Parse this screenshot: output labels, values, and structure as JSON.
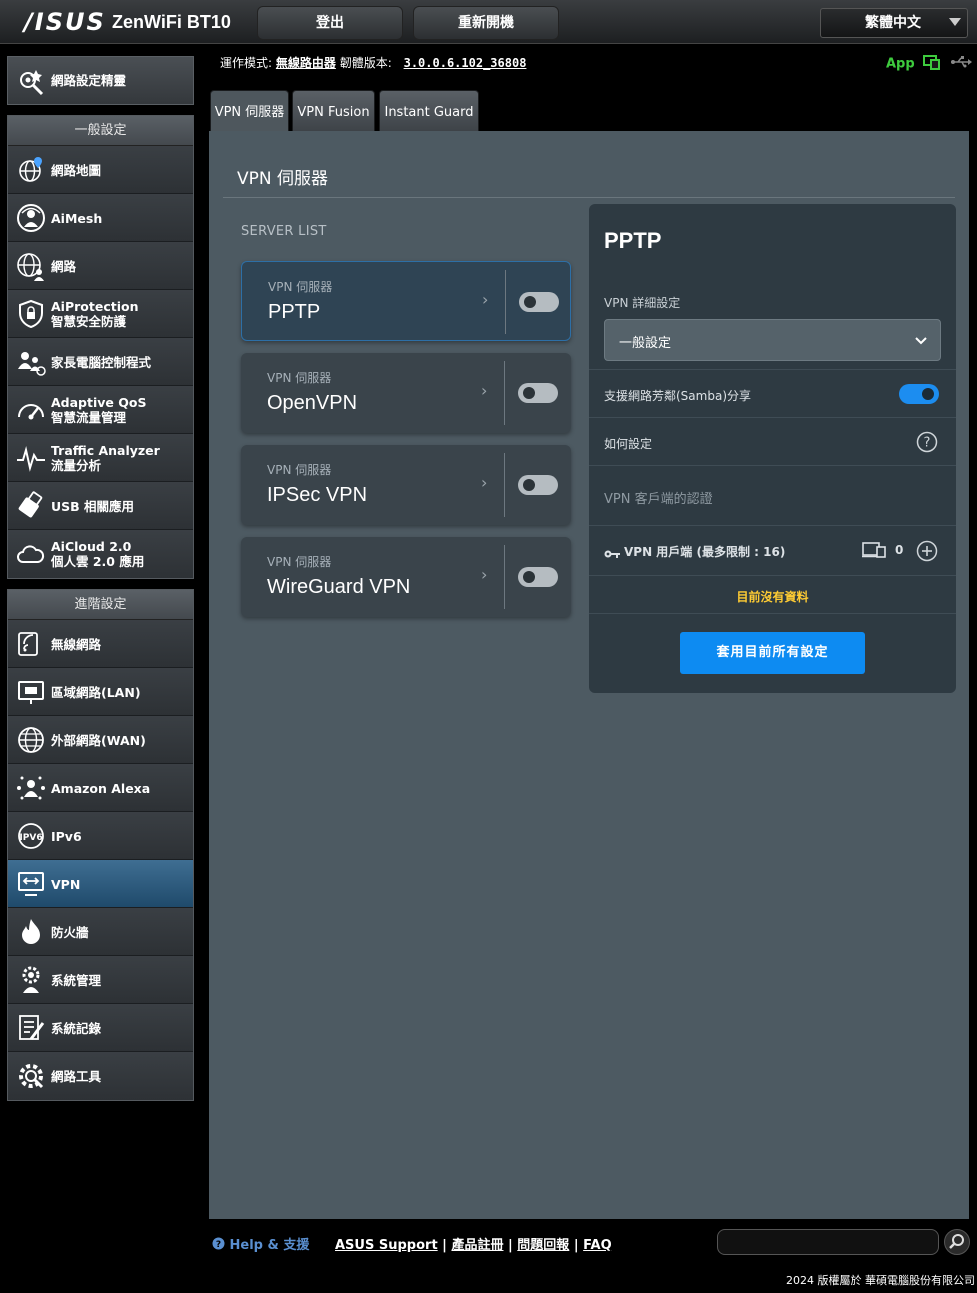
{
  "header": {
    "brand": "/ISUS",
    "model": "ZenWiFi BT10",
    "logout_label": "登出",
    "reboot_label": "重新開機",
    "language": "繁體中文"
  },
  "info": {
    "mode_label": "運作模式:",
    "mode_value": "無線路由器",
    "fw_label": "韌體版本:",
    "fw_value": "3.0.0.6.102_36808",
    "app_label": "App"
  },
  "sidebar": {
    "wizard": {
      "label": "網路設定精靈",
      "icon": "wizard-icon"
    },
    "general": {
      "header": "一般設定",
      "items": [
        {
          "label": "網路地圖",
          "icon": "network-map-icon"
        },
        {
          "label": "AiMesh",
          "icon": "aimesh-icon"
        },
        {
          "label": "網路",
          "icon": "guest-network-icon"
        },
        {
          "label": "AiProtection",
          "label2": "智慧安全防護",
          "icon": "shield-icon"
        },
        {
          "label": "家長電腦控制程式",
          "icon": "parental-control-icon"
        },
        {
          "label": "Adaptive QoS",
          "label2": "智慧流量管理",
          "icon": "qos-gauge-icon"
        },
        {
          "label": "Traffic Analyzer",
          "label2": "流量分析",
          "icon": "traffic-analyzer-icon"
        },
        {
          "label": "USB 相關應用",
          "icon": "usb-icon"
        },
        {
          "label": "AiCloud 2.0",
          "label2": "個人雲 2.0 應用",
          "icon": "cloud-icon"
        }
      ]
    },
    "advanced": {
      "header": "進階設定",
      "items": [
        {
          "label": "無線網路",
          "icon": "wireless-icon"
        },
        {
          "label": "區域網路(LAN)",
          "icon": "lan-icon"
        },
        {
          "label": "外部網路(WAN)",
          "icon": "wan-globe-icon"
        },
        {
          "label": "Amazon Alexa",
          "icon": "alexa-icon"
        },
        {
          "label": "IPv6",
          "icon": "ipv6-icon"
        },
        {
          "label": "VPN",
          "icon": "vpn-icon"
        },
        {
          "label": "防火牆",
          "icon": "firewall-icon"
        },
        {
          "label": "系統管理",
          "icon": "admin-icon"
        },
        {
          "label": "系統記錄",
          "icon": "syslog-icon"
        },
        {
          "label": "網路工具",
          "icon": "network-tools-icon"
        }
      ]
    }
  },
  "tabs": [
    {
      "label": "VPN 伺服器",
      "active": true
    },
    {
      "label": "VPN Fusion",
      "active": false
    },
    {
      "label": "Instant Guard",
      "active": false
    }
  ],
  "main": {
    "title": "VPN 伺服器",
    "server_list_label": "SERVER LIST",
    "servers": [
      {
        "sub": "VPN 伺服器",
        "name": "PPTP",
        "enabled": false,
        "selected": true
      },
      {
        "sub": "VPN 伺服器",
        "name": "OpenVPN",
        "enabled": false,
        "selected": false
      },
      {
        "sub": "VPN 伺服器",
        "name": "IPSec VPN",
        "enabled": false,
        "selected": false
      },
      {
        "sub": "VPN 伺服器",
        "name": "WireGuard VPN",
        "enabled": false,
        "selected": false
      }
    ]
  },
  "panel": {
    "title": "PPTP",
    "detail_label": "VPN 詳細設定",
    "detail_select": "一般設定",
    "samba_label": "支援網路芳鄰(Samba)分享",
    "samba_enabled": true,
    "howto_label": "如何設定",
    "client_auth_label": "VPN 客戶端的認證",
    "users_label": "VPN 用戶端 (最多限制 : 16)",
    "users_count": "0",
    "no_data": "目前沒有資料",
    "apply_label": "套用目前所有設定"
  },
  "footer": {
    "help": "Help & 支援",
    "links": [
      "ASUS Support",
      "產品註冊",
      "問題回報",
      "FAQ"
    ],
    "copyright": "2024 版權屬於 華碩電腦股份有限公司"
  },
  "colors": {
    "accent": "#0d8bf2",
    "nodata": "#ffcc33",
    "app_green": "#3ecb3e"
  }
}
